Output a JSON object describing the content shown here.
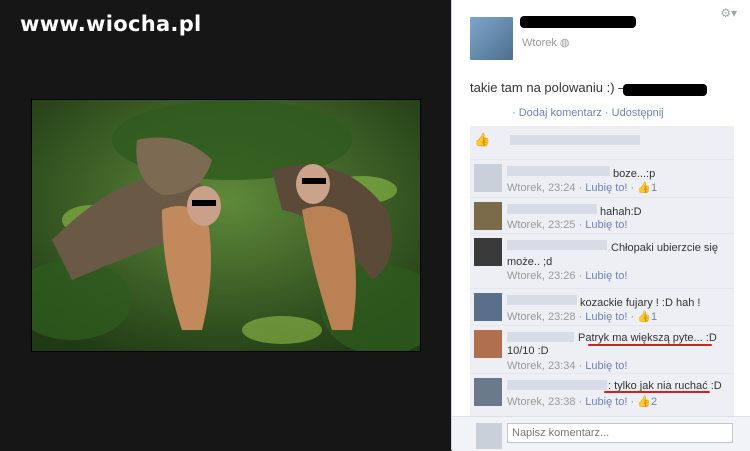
{
  "watermark": "www.wiocha.pl",
  "post": {
    "timestamp": "Wtorek",
    "caption": "takie tam na polowaniu :) — z:",
    "actions": "· Dodaj komentarz · Udostępnij"
  },
  "comments": [
    {
      "text": "boze...:p",
      "meta": "Wtorek, 23:24 ·",
      "like": "Lubię to!",
      "count": "· 👍1"
    },
    {
      "text": "hahah:D",
      "meta": "Wtorek, 23:25 ·",
      "like": "Lubię to!",
      "count": ""
    },
    {
      "text": "Chłopaki ubierzcie się",
      "text2": "może.. ;d",
      "meta": "Wtorek, 23:26 ·",
      "like": "Lubię to!",
      "count": ""
    },
    {
      "text": "kozackie fujary ! :D hah !",
      "meta": "Wtorek, 23:28 ·",
      "like": "Lubię to!",
      "count": "· 👍1"
    },
    {
      "text": "Patryk ma większą pyte... :D",
      "text2": "10/10 :D",
      "meta": "Wtorek, 23:34 ·",
      "like": "Lubię to!",
      "count": ""
    },
    {
      "text": ": tylko jak nia ruchać :D",
      "meta": "Wtorek, 23:38 ·",
      "like": "Lubię to!",
      "count": "· 👍2"
    }
  ],
  "composer": {
    "placeholder": "Napisz komentarz..."
  }
}
